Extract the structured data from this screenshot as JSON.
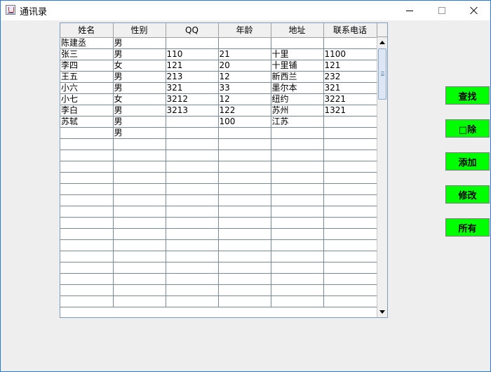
{
  "window": {
    "title": "通讯录",
    "icon": "java-coffee-cup-icon",
    "controls": {
      "minimize": "minimize-icon",
      "maximize": "maximize-icon",
      "close": "close-icon"
    }
  },
  "table": {
    "columns": [
      "姓名",
      "性别",
      "QQ",
      "年龄",
      "地址",
      "联系电话"
    ],
    "rows": [
      [
        "陈建丞",
        "男",
        "",
        "",
        "",
        ""
      ],
      [
        "张三",
        "男",
        "110",
        "21",
        "十里",
        "1100"
      ],
      [
        "李四",
        "女",
        "121",
        "20",
        "十里铺",
        "121"
      ],
      [
        "王五",
        "男",
        "213",
        "12",
        "新西兰",
        "232"
      ],
      [
        "小六",
        "男",
        "321",
        "33",
        "墨尔本",
        "321"
      ],
      [
        "小七",
        "女",
        "3212",
        "12",
        "纽约",
        "3221"
      ],
      [
        "李白",
        "男",
        "3213",
        "122",
        "苏州",
        "1321"
      ],
      [
        "苏轼",
        "男",
        "",
        "100",
        "江苏",
        ""
      ],
      [
        "",
        "男",
        "",
        "",
        "",
        ""
      ],
      [
        "",
        "",
        "",
        "",
        "",
        ""
      ],
      [
        "",
        "",
        "",
        "",
        "",
        ""
      ],
      [
        "",
        "",
        "",
        "",
        "",
        ""
      ],
      [
        "",
        "",
        "",
        "",
        "",
        ""
      ],
      [
        "",
        "",
        "",
        "",
        "",
        ""
      ],
      [
        "",
        "",
        "",
        "",
        "",
        ""
      ],
      [
        "",
        "",
        "",
        "",
        "",
        ""
      ],
      [
        "",
        "",
        "",
        "",
        "",
        ""
      ],
      [
        "",
        "",
        "",
        "",
        "",
        ""
      ],
      [
        "",
        "",
        "",
        "",
        "",
        ""
      ],
      [
        "",
        "",
        "",
        "",
        "",
        ""
      ],
      [
        "",
        "",
        "",
        "",
        "",
        ""
      ],
      [
        "",
        "",
        "",
        "",
        "",
        ""
      ],
      [
        "",
        "",
        "",
        "",
        "",
        ""
      ],
      [
        "",
        "",
        "",
        "",
        "",
        ""
      ]
    ]
  },
  "buttons": {
    "search": "查找",
    "delete": "□除",
    "add": "添加",
    "edit": "修改",
    "all": "所有"
  },
  "colors": {
    "button_bg": "#00ff00",
    "window_bg": "#eeeeee",
    "window_border": "#2b78d8",
    "grid_line": "#7a8a99"
  }
}
